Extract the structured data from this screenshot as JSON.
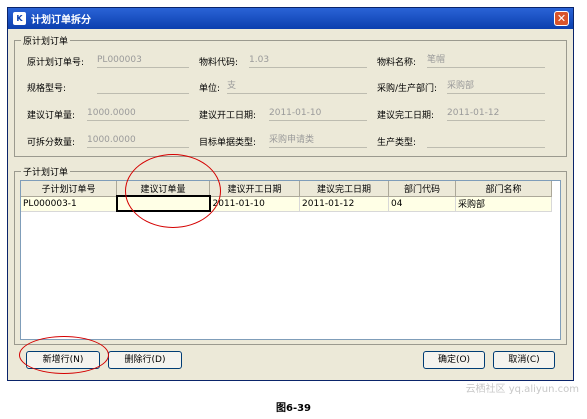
{
  "window": {
    "title": "计划订单拆分",
    "icon": "app-icon"
  },
  "orig_group": {
    "legend": "原计划订单",
    "rows": [
      [
        {
          "label": "原计划订单号:",
          "value": "PL000003"
        },
        {
          "label": "物料代码:",
          "value": "1.03"
        },
        {
          "label": "物料名称:",
          "value": "笔帽"
        }
      ],
      [
        {
          "label": "规格型号:",
          "value": ""
        },
        {
          "label": "单位:",
          "value": "支"
        },
        {
          "label": "采购/生产部门:",
          "value": "采购部"
        }
      ],
      [
        {
          "label": "建议订单量:",
          "value": "1000.0000"
        },
        {
          "label": "建议开工日期:",
          "value": "2011-01-10"
        },
        {
          "label": "建议完工日期:",
          "value": "2011-01-12"
        }
      ],
      [
        {
          "label": "可拆分数量:",
          "value": "1000.0000"
        },
        {
          "label": "目标单据类型:",
          "value": "采购申请类"
        },
        {
          "label": "生产类型:",
          "value": ""
        }
      ]
    ]
  },
  "child_group": {
    "legend": "子计划订单",
    "columns": [
      "子计划订单号",
      "建议订单量",
      "建议开工日期",
      "建议完工日期",
      "部门代码",
      "部门名称"
    ],
    "rows": [
      [
        "PL000003-1",
        "",
        "2011-01-10",
        "2011-01-12",
        "04",
        "采购部"
      ]
    ]
  },
  "buttons": {
    "add_row": "新增行(N)",
    "delete_row": "删除行(D)",
    "ok": "确定(O)",
    "cancel": "取消(C)"
  },
  "caption": "图6-39",
  "watermark": "云栖社区 yq.aliyun.com"
}
